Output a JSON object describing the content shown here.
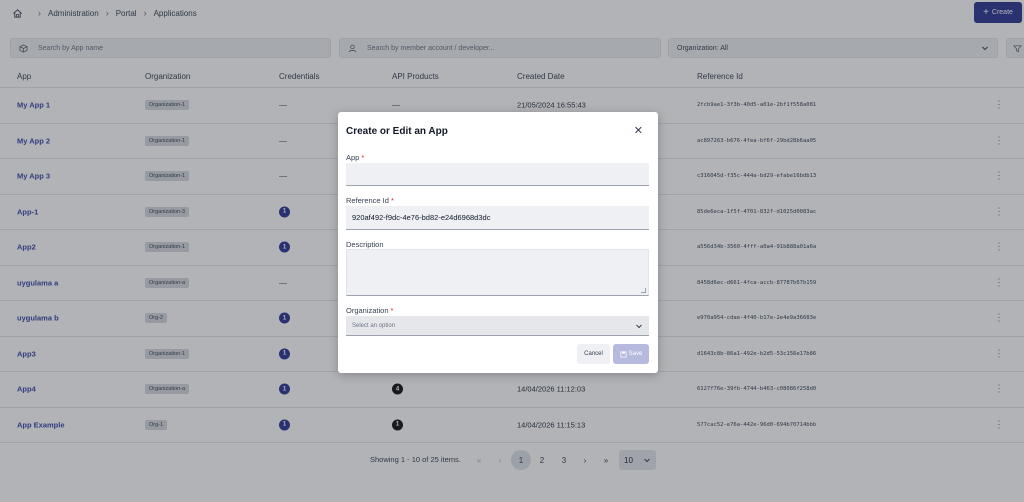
{
  "breadcrumb": [
    "Administration",
    "Portal",
    "Applications"
  ],
  "create_button": "Create",
  "filters": {
    "app_placeholder": "Search by App name",
    "member_placeholder": "Search by member account / developer...",
    "organization_value": "Organization: All"
  },
  "table": {
    "headers": [
      "App",
      "Organization",
      "Credentials",
      "API Products",
      "Created Date",
      "Reference Id"
    ],
    "rows": [
      {
        "app": "My App 1",
        "org": "Organization-1",
        "cred": "—",
        "api": "—",
        "date": "21/05/2024 16:55:43",
        "ref": "2fcb9ae1-3f3b-40d5-a01e-2bf1f558a081"
      },
      {
        "app": "My App 2",
        "org": "Organization-1",
        "cred": "—",
        "api": "",
        "date": "",
        "ref": "ac897263-b676-4fea-bf6f-29bd28b6aa05"
      },
      {
        "app": "My App 3",
        "org": "Organization-1",
        "cred": "—",
        "api": "",
        "date": "",
        "ref": "c316045d-f35c-444a-bd29-efabe16bdb13"
      },
      {
        "app": "App-1",
        "org": "Organization-3",
        "cred": "1",
        "api": "",
        "date": "",
        "ref": "85de6eca-1f5f-4701-832f-d1025d0083ac"
      },
      {
        "app": "App2",
        "org": "Organization-1",
        "cred": "1",
        "api": "",
        "date": "",
        "ref": "a556d34b-3560-4fff-a0a4-91b888a01a6a"
      },
      {
        "app": "uygulama a",
        "org": "Organization-a",
        "cred": "—",
        "api": "",
        "date": "",
        "ref": "8458d6ec-d661-4fca-accb-87787b67b159"
      },
      {
        "app": "uygulama b",
        "org": "Org-2",
        "cred": "1",
        "api": "",
        "date": "",
        "ref": "e970a954-cdae-4f40-b17e-2e4e9a36683e"
      },
      {
        "app": "App3",
        "org": "Organization-1",
        "cred": "1",
        "api": "",
        "date": "",
        "ref": "d1643c8b-86a1-492e-b2d5-53c156e17b86"
      },
      {
        "app": "App4",
        "org": "Organization-a",
        "cred": "1",
        "api": "4",
        "date": "14/04/2026 11:12:03",
        "ref": "6127f76e-39fb-4744-b463-c08086f258d0"
      },
      {
        "app": "App Example",
        "org": "Org-1",
        "cred": "1",
        "api": "1",
        "date": "14/04/2026 11:15:13",
        "ref": "577cac52-e76a-442e-96d0-694b70714bbb"
      }
    ]
  },
  "pagination": {
    "info": "Showing 1 - 10 of 25 items.",
    "pages": [
      "1",
      "2",
      "3"
    ],
    "page_size": "10"
  },
  "modal": {
    "title": "Create or Edit an App",
    "app_label": "App",
    "app_value": "",
    "ref_label": "Reference Id",
    "ref_value": "920af492-f9dc-4e76-bd82-e24d6968d3dc",
    "desc_label": "Description",
    "desc_value": "",
    "org_label": "Organization",
    "org_placeholder": "Select an option",
    "required_mark": "*",
    "cancel_label": "Cancel",
    "save_label": "Save"
  },
  "colors": {
    "primary": "#2d3494",
    "link": "#3b46a8",
    "required": "#dc2626",
    "save_disabled": "#b6badf"
  }
}
